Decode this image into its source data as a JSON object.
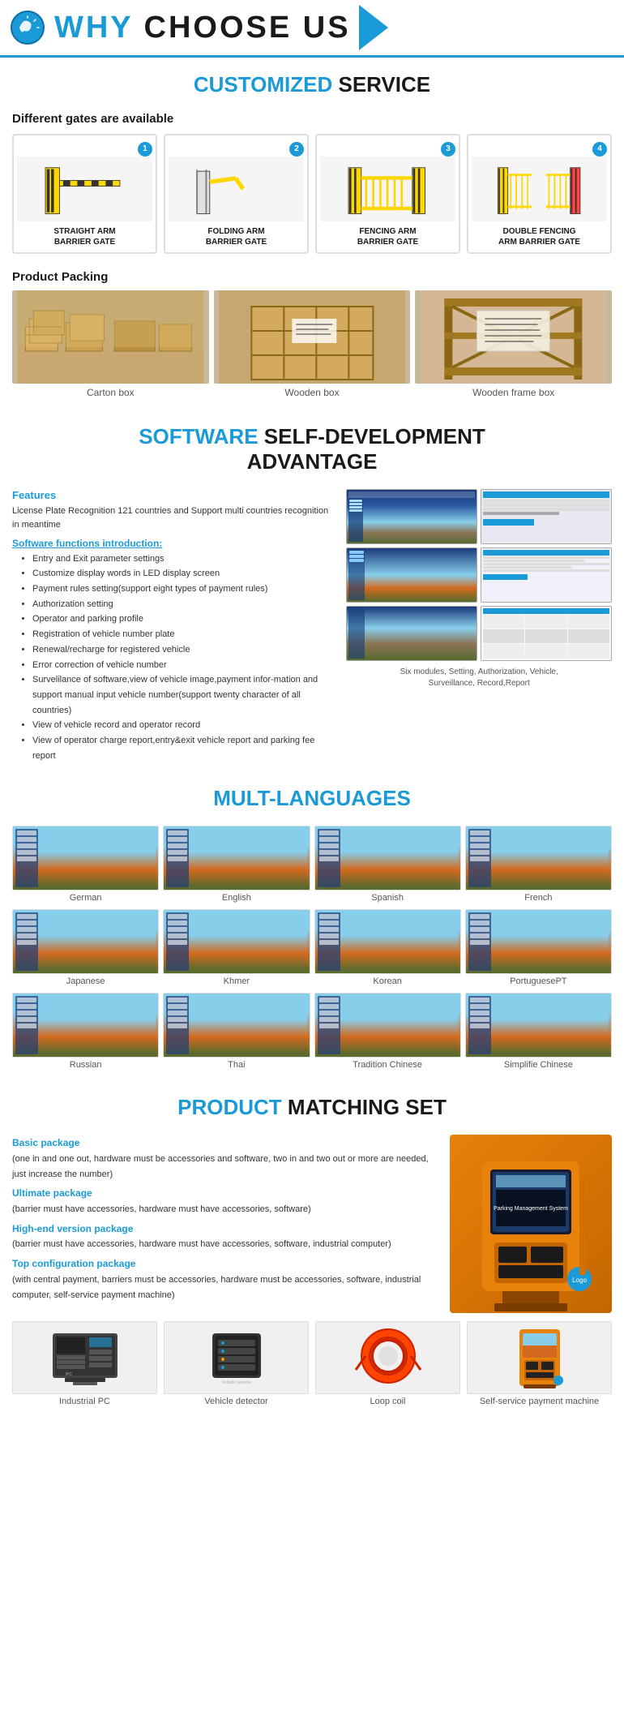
{
  "header": {
    "title": "WHY CHOOSE US",
    "title_blue": "WHY ",
    "title_normal": "CHOOSE US"
  },
  "customized": {
    "title_blue": "CUSTOMIZED",
    "title_normal": " SERVICE",
    "subtitle": "Different gates are available",
    "gates": [
      {
        "num": "1",
        "label": "STRAIGHT ARM\nBARRIER GATE"
      },
      {
        "num": "2",
        "label": "FOLDING ARM\nBARRIER GATE"
      },
      {
        "num": "3",
        "label": "FENCING ARM\nBARRIER GATE"
      },
      {
        "num": "4",
        "label": "DOUBLE FENCING\nARM BARRIER GATE"
      }
    ]
  },
  "packing": {
    "title": "Product Packing",
    "items": [
      {
        "label": "Carton box"
      },
      {
        "label": "Wooden box"
      },
      {
        "label": "Wooden frame box"
      }
    ]
  },
  "software": {
    "title_blue": "SOFTWARE",
    "title_normal": " SELF-DEVELOPMENT\nADVANTAGE",
    "features_title": "Features",
    "features_text": "License Plate Recognition 121 countries and Support multi countries recognition in meantime",
    "intro_title": "Software functions introduction:",
    "functions": [
      "Entry and Exit parameter settings",
      "Customize display words in LED display screen",
      "Payment rules setting(support eight types of payment rules)",
      "Authorization setting",
      "Operator and parking profile",
      "Registration of vehicle number plate",
      "Renewal/recharge for registered vehicle",
      "Error correction of vehicle number",
      "Survelilance of software,view of vehicle image,payment information and support manual input vehicle number(support twenty character of all countries)",
      "View of vehicle record and operator record",
      "View of operator charge report,entry&exit vehicle report and parking fee report"
    ],
    "caption": "Six modules, Setting, Authorization, Vehicle,\nSurveillance, Record,Report"
  },
  "languages": {
    "title_blue": "MULT-LANGUAGES",
    "items": [
      "German",
      "English",
      "Spanish",
      "French",
      "Japanese",
      "Khmer",
      "Korean",
      "PortuguesePT",
      "Russian",
      "Thai",
      "Tradition Chinese",
      "Simplifie Chinese"
    ]
  },
  "product": {
    "title_blue": "PRODUCT",
    "title_normal": " MATCHING SET",
    "packages": [
      {
        "title": "Basic package",
        "desc": "(one in and one out, hardware must be accessories and software, two in and two out or more are needed, just increase the number)"
      },
      {
        "title": "Ultimate package",
        "desc": "(barrier must have accessories, hardware must have accessories, software)"
      },
      {
        "title": "High-end version package",
        "desc": "(barrier must have accessories, hardware must have accessories, software, industrial computer)"
      },
      {
        "title": "Top configuration package",
        "desc": "(with central payment, barriers must be accessories, hardware must be accessories, software, industrial computer, self-service payment machine)"
      }
    ],
    "components": [
      {
        "label": "Industrial PC"
      },
      {
        "label": "Vehicle detector"
      },
      {
        "label": "Loop coil"
      },
      {
        "label": "Self-service payment machine"
      }
    ]
  }
}
